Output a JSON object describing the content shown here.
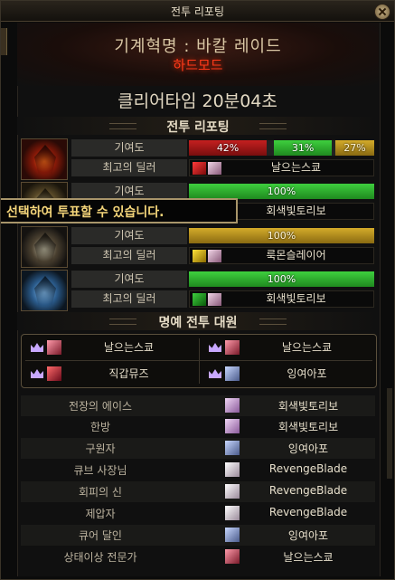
{
  "window": {
    "title": "전투 리포팅"
  },
  "raid": {
    "name": "기계혁명 : 바칼 레이드",
    "mode": "하드모드",
    "clear_time": "클리어타임  20분04초"
  },
  "section_report": {
    "title": "전투 리포팅"
  },
  "labels": {
    "contribution": "기여도",
    "best_dealer": "최고의 딜러"
  },
  "parties": [
    {
      "icon": "red-raid-emblem-icon",
      "segments": [
        {
          "value": "42%",
          "pct": 42,
          "color": "red"
        },
        {
          "value": "31%",
          "pct": 31,
          "color": "green"
        },
        {
          "value": "27%",
          "pct": 27,
          "color": "gold"
        }
      ],
      "dealer": "날으는스쿄",
      "class_icon": "red-slash-class-icon"
    },
    {
      "icon": "gold-raid-emblem-icon",
      "segments": [
        {
          "value": "100%",
          "pct": 100,
          "color": "green"
        }
      ],
      "dealer": "회색빛토리보",
      "class_icon": "green-class-icon"
    },
    {
      "icon": "dark-raid-emblem-icon",
      "segments": [
        {
          "value": "100%",
          "pct": 100,
          "color": "gold"
        }
      ],
      "dealer": "룩몬슬레이어",
      "class_icon": "yellow-4-class-icon"
    },
    {
      "icon": "blue-raid-emblem-icon",
      "segments": [
        {
          "value": "100%",
          "pct": 100,
          "color": "green"
        }
      ],
      "dealer": "회색빛토리보",
      "class_icon": "green-2-class-icon"
    }
  ],
  "tooltip": {
    "text": "선택하여 투표할 수 있습니다."
  },
  "section_honor": {
    "title": "명예 전투 대원"
  },
  "honor": [
    {
      "name": "날으는스쿄",
      "crown": "gold-crown-icon"
    },
    {
      "name": "날으는스쿄",
      "crown": "gold-crown-icon"
    },
    {
      "name": "직갑뮤즈",
      "crown": "silver-crown-icon"
    },
    {
      "name": "잉여아포",
      "crown": "silver-crown-icon"
    }
  ],
  "awards": [
    {
      "title": "전장의 에이스",
      "player": "회색빛토리보"
    },
    {
      "title": "한방",
      "player": "회색빛토리보"
    },
    {
      "title": "구원자",
      "player": "잉여아포"
    },
    {
      "title": "큐브 사장님",
      "player": "RevengeBlade"
    },
    {
      "title": "회피의 신",
      "player": "RevengeBlade"
    },
    {
      "title": "제압자",
      "player": "RevengeBlade"
    },
    {
      "title": "큐어 달인",
      "player": "잉여아포"
    },
    {
      "title": "상태이상 전문가",
      "player": "날으는스쿄"
    }
  ],
  "colors": {
    "red": "#c42020",
    "green": "#3ecf3e",
    "gold": "#d4ac2a",
    "tooltip_text": "#f4d57a",
    "hardmode": "#ff3a1a"
  }
}
